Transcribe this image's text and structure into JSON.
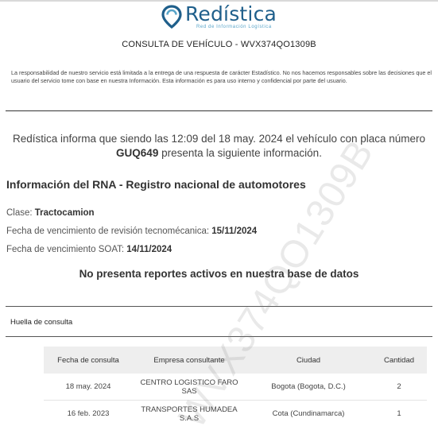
{
  "brand": {
    "name": "Redística",
    "tagline": "Red de Información Logística"
  },
  "consulta_title": "CONSULTA DE VEHÍCULO - WVX374QO1309B",
  "disclaimer": "La responsabilidad de nuestro servicio está limitada a la entrega de una respuesta de carácter Estadístico. No nos hacemos responsables sobre las decisiones que el usuario del servicio tome con base en nuestra Información. Esta información es para uso interno y confidencial por parte del usuario.",
  "intro": {
    "before_plate": "Redística informa que siendo las 12:09 del 18 may. 2024 el vehículo con placa número ",
    "plate": "GUQ649",
    "after_plate": " presenta la siguiente información."
  },
  "rna_title": "Información del RNA - Registro nacional de automotores",
  "fields": [
    {
      "label": "Clase: ",
      "value": "Tractocamion"
    },
    {
      "label": "Fecha de vencimiento de revisión tecnomécanica: ",
      "value": "15/11/2024"
    },
    {
      "label": "Fecha de vencimiento SOAT: ",
      "value": "14/11/2024"
    }
  ],
  "no_reports": "No presenta reportes activos en nuestra base de datos",
  "huella_label": "Huella de consulta",
  "table": {
    "headers": [
      "Fecha de consulta",
      "Empresa consultante",
      "Ciudad",
      "Cantidad"
    ],
    "rows": [
      [
        "18 may. 2024",
        "CENTRO LOGISTICO FARO SAS",
        "Bogota (Bogota, D.C.)",
        "2"
      ],
      [
        "16 feb. 2023",
        "TRANSPORTES HUMADEA S.A.S",
        "Cota (Cundinamarca)",
        "1"
      ]
    ]
  },
  "watermark": "WVX374QO1309B",
  "colors": {
    "brand_primary": "#1f5f8b",
    "brand_secondary": "#5aa5c9",
    "header_bg": "#eeeeee"
  }
}
